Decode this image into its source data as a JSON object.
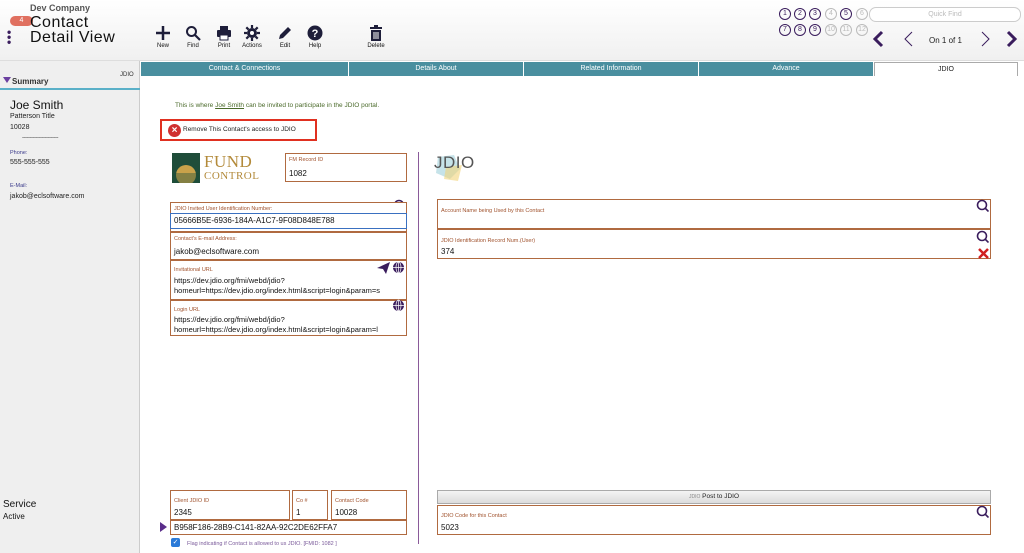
{
  "header": {
    "company": "Dev Company",
    "badge": "4",
    "title_line1": "Contact",
    "title_line2": "Detail View",
    "toolbar": {
      "new": "New",
      "find": "Find",
      "print": "Print",
      "actions": "Actions",
      "edit": "Edit",
      "help": "Help",
      "delete": "Delete"
    },
    "record_circles": [
      "1",
      "2",
      "3",
      "4",
      "5",
      "6",
      "7",
      "8",
      "9",
      "10",
      "11",
      "12"
    ],
    "quick_find_placeholder": "Quick Find",
    "record_position": "On 1 of 1"
  },
  "tabs": [
    {
      "label": "Contact & Connections",
      "active": false
    },
    {
      "label": "Details About",
      "active": false
    },
    {
      "label": "Related Information",
      "active": false
    },
    {
      "label": "Advance",
      "active": false
    },
    {
      "label": "JDIO",
      "active": true
    }
  ],
  "sidebar": {
    "summary_label": "Summary",
    "jdio_tag": "JDIO",
    "name": "Joe Smith",
    "title": "Patterson Title",
    "zip": "10028",
    "separator": "------------------------",
    "phone_label": "Phone:",
    "phone": "555-555-555",
    "email_label": "E-Mail:",
    "email": "jakob@eclsoftware.com",
    "service_label": "Service",
    "service_status": "Active"
  },
  "main": {
    "intro_prefix": "This is where ",
    "intro_name": "Joe Smith",
    "intro_suffix": " can be invited to participate in the JDIO portal.",
    "remove_access": "Remove This Contact's access to JDIO",
    "logo_line1": "FUND",
    "logo_line2": "CONTROL",
    "jdio_logo": "JDIO",
    "fm_record_label": "FM Record ID",
    "fm_record_value": "1082",
    "invited_uid_label": "JDIO Invited User Identification Number:",
    "invited_uid_value": "05666B5E-6936-184A-A1C7-9F08D848E788",
    "email_label": "Contact's E-mail Address:",
    "email_value": "jakob@eclsoftware.com",
    "invitational_url_label": "Invitational URL",
    "invitational_url_line1": "https://dev.jdio.org/fmi/webd/jdio?",
    "invitational_url_line2": "homeurl=https://dev.jdio.org/index.html&script=login&param=s",
    "login_url_label": "Login URL",
    "login_url_line1": "https://dev.jdio.org/fmi/webd/jdio?",
    "login_url_line2": "homeurl=https://dev.jdio.org/index.html&script=login&param=l",
    "account_name_label": "Account Name being Used by this Contact",
    "account_name_value": "",
    "jdio_record_label": "JDIO Identification Record Num.(User)",
    "jdio_record_value": "374",
    "client_jdio_label": "Client JDIO ID",
    "client_jdio_value": "2345",
    "co_label": "Co #",
    "co_value": "1",
    "contact_code_label": "Contact Code",
    "contact_code_value": "10028",
    "guid_value": "B958F186-28B9-C141-82AA-92C2DE62FFA7",
    "post_button": "Post to JDIO",
    "post_button_tag": "JDIO",
    "jdio_code_label": "JDIO Code for this Contact",
    "jdio_code_value": "5023",
    "flag_label": "Flag indicating if Contact is allowed to us JDIO. [FMID: 1082 ]"
  },
  "colors": {
    "tab_bg": "#4a8f9f",
    "accent_purple": "#3a1d5d",
    "field_border": "#b06a40",
    "remove_red": "#e03020"
  }
}
